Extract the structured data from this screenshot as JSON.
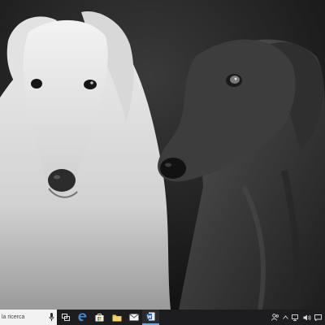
{
  "desktop": {
    "wallpaper": "black-and-white-photo-two-borzoi-dogs"
  },
  "taskbar": {
    "search": {
      "placeholder": "la ricerca",
      "icon": "microphone-icon"
    },
    "pinned": [
      {
        "name": "task-view",
        "icon": "task-view-icon"
      },
      {
        "name": "edge",
        "icon": "edge-icon"
      },
      {
        "name": "store",
        "icon": "store-icon"
      },
      {
        "name": "file-explorer",
        "icon": "folder-icon"
      },
      {
        "name": "mail",
        "icon": "mail-icon"
      },
      {
        "name": "word",
        "icon": "word-icon"
      }
    ],
    "tray": [
      "people-icon",
      "chevron-up-icon",
      "network-icon",
      "volume-icon",
      "action-center-icon"
    ],
    "colors": {
      "bar": "#1d1d1f",
      "search_bg": "#f2f2f2",
      "accent": "#78a7d8"
    }
  }
}
